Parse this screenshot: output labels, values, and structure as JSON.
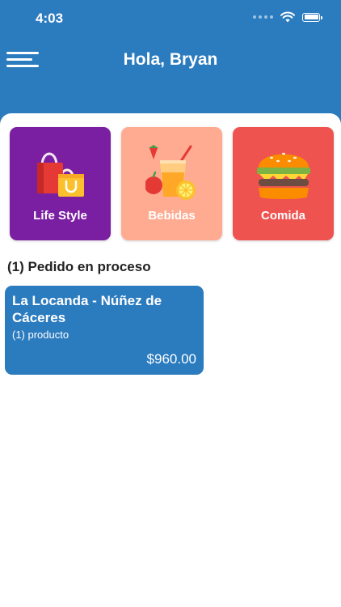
{
  "status_bar": {
    "time": "4:03"
  },
  "header": {
    "greeting": "Hola, Bryan"
  },
  "icons": {
    "menu": "hamburger-menu-icon",
    "wifi": "wifi-icon",
    "battery": "battery-icon",
    "signal": "signal-icon"
  },
  "categories": [
    {
      "label": "Life Style",
      "icon": "shopping-bags-icon",
      "color": "#7b1fa2"
    },
    {
      "label": "Bebidas",
      "icon": "juice-drink-icon",
      "color": "#ffab91"
    },
    {
      "label": "Comida",
      "icon": "burger-icon",
      "color": "#ef5350"
    }
  ],
  "orders_section": {
    "title": "(1) Pedido en proceso",
    "orders": [
      {
        "name": "La Locanda - Núñez de Cáceres",
        "count": "(1) producto",
        "price": "$960.00"
      }
    ]
  },
  "colors": {
    "primary": "#2b7bbf",
    "background": "#ffffff"
  }
}
